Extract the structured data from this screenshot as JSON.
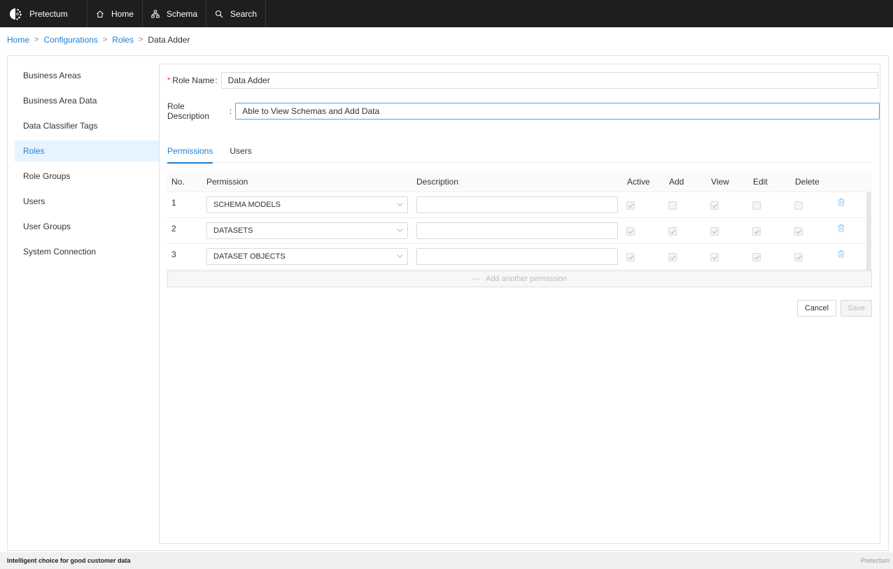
{
  "nav": {
    "brand": "Pretectum",
    "items": [
      {
        "label": "Home",
        "icon": "home-icon"
      },
      {
        "label": "Schema",
        "icon": "schema-icon"
      },
      {
        "label": "Search",
        "icon": "search-icon"
      }
    ]
  },
  "breadcrumb": {
    "items": [
      "Home",
      "Configurations",
      "Roles"
    ],
    "current": "Data Adder",
    "separator": ">"
  },
  "sidebar": {
    "items": [
      {
        "label": "Business Areas",
        "active": false
      },
      {
        "label": "Business Area Data",
        "active": false
      },
      {
        "label": "Data Classifier Tags",
        "active": false
      },
      {
        "label": "Roles",
        "active": true
      },
      {
        "label": "Role Groups",
        "active": false
      },
      {
        "label": "Users",
        "active": false
      },
      {
        "label": "User Groups",
        "active": false
      },
      {
        "label": "System Connection",
        "active": false
      }
    ]
  },
  "form": {
    "required_mark": "*",
    "role_name_label": "Role Name",
    "role_name_value": "Data Adder",
    "role_desc_label": "Role Description",
    "role_desc_value": "Able to View Schemas and Add Data",
    "colon": ":"
  },
  "tabs": [
    {
      "label": "Permissions",
      "active": true
    },
    {
      "label": "Users",
      "active": false
    }
  ],
  "table": {
    "headers": [
      "No.",
      "Permission",
      "Description",
      "Active",
      "Add",
      "View",
      "Edit",
      "Delete"
    ],
    "rows": [
      {
        "no": "1",
        "permission": "SCHEMA MODELS",
        "description": "",
        "active": true,
        "add": false,
        "view": true,
        "edit": false,
        "delete": false
      },
      {
        "no": "2",
        "permission": "DATASETS",
        "description": "",
        "active": true,
        "add": true,
        "view": true,
        "edit": true,
        "delete": true
      },
      {
        "no": "3",
        "permission": "DATASET OBJECTS",
        "description": "",
        "active": true,
        "add": true,
        "view": true,
        "edit": true,
        "delete": true
      }
    ]
  },
  "add_permission_label": "Add another permission",
  "buttons": {
    "cancel": "Cancel",
    "save": "Save"
  },
  "footer": {
    "tagline": "Intelligent choice for good customer data",
    "brand": "Pretectum"
  },
  "colors": {
    "accent": "#1d7fd6",
    "nav_bg": "#1e1e1e",
    "active_bg": "#e6f4ff",
    "required": "#f5222d",
    "trash": "#91caff"
  }
}
